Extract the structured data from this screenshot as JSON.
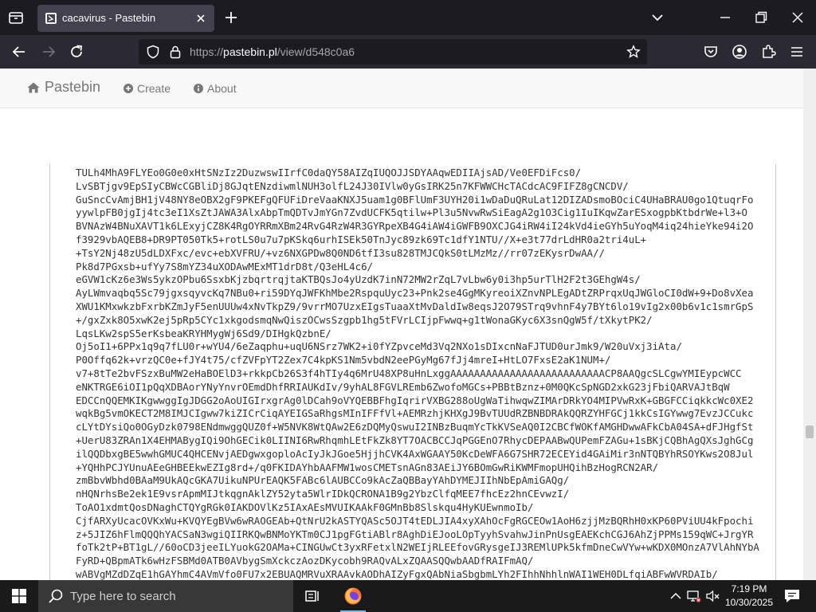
{
  "browser": {
    "tab": {
      "title": "cacavirus - Pastebin"
    },
    "url": {
      "prefix": "https://",
      "host": "pastebin.pl",
      "path": "/view/d548c0a6"
    }
  },
  "site": {
    "brand": "Pastebin",
    "nav": [
      {
        "label": "Create"
      },
      {
        "label": "About"
      }
    ]
  },
  "paste": {
    "lines": [
      "TULh4MhA9FLYEo0G0e0xHtSNzIz2DuzwswIIrfC0daQY58AIZqIUQOJJSDYAAqwEDIIAjsAD/Ve0EFDiFcs0/",
      "LvSBTjgv9EpSIyCBWcCGBliDj8GJqtENzdiwmlNUH3olfL24J30IVlw0yGsIRK25n7KFWWCHcTACdcAC9FIFZ8gCNCDV/",
      "GuSncCvAmjBH1jV48NY8eOBX2gF9PKEFgQFUFiDreVaaKNXJ5uam1g0BFlUmF3UYH20i1wDaDuQRuLat12DIZADsmoBOciC4UHaBRAU0go1QtuqrFo",
      "yywlpFB0jgIj4tc3eI1XsZtJAWA3AlxAbpTmQDTvJmYGn7ZvdUCFK5qtilw+Pl3u5NvwRwSiEagA2g1O3Cig1IuIKqwZarESxogpbKtbdrWe+l3+O",
      "BVNAzW4BNuXAVT1k6LExyjCZ8K4RgOYRRmXBm24RvG4RzW4R3GYRpeXB4G4iAW4iGWFB9OXCJG4iRW4iI24kVd4ieGYh5uYoqM4iq24hieYke94i2O",
      "f3929vbAQEB8+DR9PT050Tk5+rotLS0u7u7pKSkq6urhISEk50TnJyc89zk69Tc1dfY1NTU//X+e3t77drLdHR0a2tri4uL+",
      "+TsY2Nj48zU5dLDXFxc/evc+ebXVFRU/+vz6NXGPDw8Q0ND6tfI3su828TMJCQkS0tLMzMz//rr07zEKysrDwAA//",
      "Pk8d7PGxsb+ufYy7S8mYZ34uXODAwMExMT1drD8t/Q3eHL4c6/",
      "eGVW1cKz6e3Ws5ykzOPbu6SsxbKjzbqrtrqjtaKTBQsJo4yUzdK7inN72MW2rZqL7vLbw6y0i3hp5urTlH2F2t3GEhgW4s/",
      "AyLWmvaqbq5Sc79jgxsqyvcKq7NBu0+ri59DYqJWFKhMbe2RspquUyc23+Pnk2se4GgMKyreoiXZnvNPLEgADtZRPrqxUqJWGloCI0dW+9+Do8vXea",
      "XWU1KMxwkzbFxrbKZmJyF5enUUUw4xNvTkpZ9/9vrrMO7UzxEIgsTuaaXtMvDaldIw8eqsJ2O79STrq9vhnF4y7BYt6lo19vIg2x00b6v1c1smrGpS",
      "+/gxZxk8O5xwK2ej5pRp5CYc1xkgodsmqNwQiszOCwsSzgpb1hg5tFVrLCIjpFwwq+g1tWonaGKyc6X3snQgW5f/tXkytPK2/",
      "LqsLKw2spS5erKsbeaKRYHMygWj6Sd9/DIHgkQzbnE/",
      "Oj5oI1+6PPx1q9q7fLU0r+wYU4/6eZaqphu+uqU6NSrz7WK2+i0fYZpvceMd3Vq2NXo1sDIxcnNaFJTUD0urJmk9/W20uVxj3iAta/",
      "P0Offq62k+vrzQC0e+fJY4t75/cfZVFpYT2Zex7C4kpKS1Nm5vbdN2eePGyMg67fJj4mreI+HtLO7FxsE2aK1NUM+/",
      "v7+8tTe2bvFSzxBuMW2eHaBOElD3+rkkpCb26S3f4hTIy4q6MrU48XP8uHnLxggAAAAAAAAAAAAAAAAAAAAAAAAAACP8AAQgcSLCgwYMIEypcWCC",
      "eNKTRGE6iOI1pQqXDBAorYNyYnvrOEmdDhfRRIAUKdIv/9yhAL8FGVLREmb6ZwofoMGCs+PBBtBznz+0M0QKcSpNGD2xkG23jFbiQARVAJtBqW",
      "EDCCnQQEMKIKgwwggIgJDGG2oAoUIGIrxgrAg0lDCah9oVYQEBBFhgIqrirVXBG288oUgWaTihwqwZIMArDRkYO4MIPVwRxK+GBGFCCiqkkcWc0XE2",
      "wqkBg5vmOKECT2M8IMJCIgww7kiZICrCiqAYEIGSaRhgsMInIFFfVl+AEMRzhjKHXgJ9BvTUUdRZBNBDRAkQQRZYHFGCj1kkCsIGYwwg7EvzJCCukc",
      "cLYtDYsiQo0OGyDzk0798ENdmwggQUZ0f+W5NVK8WtQAw2E6zDQMyQswuI2INBzBuqmYcTkKVSeAQ0I2CBCfWOKfAMGHDwwAFkCbA04SA+dFJHgfSt",
      "+UerU83ZRAn1X4EHMABygIQi9OhGECik0LIINI6RwRhqmhLEtFkZk8YT7OACBCCJqPGGEnO7RhycDEPAABwQUPemFZAGu+1sBKjCQBhAgQXsJghGCg",
      "ilQQDbxgBE5wwhGMUC4QHCENvjAEDgwxgoploAcIyJkJGoe5HjjhCVK4AxWGAAY50KcDeWFA6G7SHR72ECEYid4GAiMir3nNTQBYhRSOYKws2O8Jul",
      "+YQHhPCJYUnuAEeGHBEEkwEZIg8rd+/q0FKIDAYhbAAFMW1wosCMETsnAGn83AEiJY6BOmGwRiKWMFmopUHQihBzHogRCN2AR/",
      "zmBbvWbhd0BAaM9UkAQcGKA7UikuNPUrEAQK5FABc6lAUBCCo9kAcZaQBBayYAhDYMEJIIhNbEpAmiGAQg/",
      "nHQNrhsBe2ek1E9vsrApmMIJtkqgnAklZY52yta5WlrIDkQCRONA1B9g2YbzClfqMEE7fhcEz2hnCEvwzI/",
      "ToAO1xdmtQosDNaghCTQYgRGk0IAKDOVlKz5IAxAEsMVUIKAAkF0GMnBb8Slskqu4HyKUEwnmoIb/",
      "CjfARXyUcacOVKxWu+KVQYEgBVw6wRAOGEAb+QtNrU2kASTYQASc5OJT4tEDLJIA4xyXAhOcFgRGCEOw1AoH6zjjMzBQRhH0xKP60PViUU4kFpochi",
      "z+5JIZ6hFlmQQQhYACSaN3wgiQIIRKQwBNMoYKTm0CJ1pgFGtiABlr8AghDiEJooLOpTyyhSvahwJinPnUsgEAEKchCGJ6AhZjPPMs159qWC+JrgYR",
      "foTk2tP+BT1gL//60oCD3jeeILYuokG2OAMa+CINGUwCt3yxRFetxlN2WEIjRLEEfovGRysgeIJ3REMlUPk5kfmDneCwVYw+wKDX0MOnzA7VlAhNYbA",
      "FyRD+QBpmATk6wHzFSBMd0ATB0AVbygSmXckczAozDKycobh9RAQvALxZQAASQQwbAADfRAIFmAQ/",
      "wABVgMZdDZqE1hGAYhmC4AVmVfo0FU7x2EBUAQMRVuXRAAvkAODhAIZyFgxQAbNiaSbgbmLYh2FIhhNhhlnWAI1WEH0DLfqiABFwWVRDAIb/"
    ]
  },
  "taskbar": {
    "search_placeholder": "Type here to search",
    "time": "7:19 PM",
    "date": "10/30/2025"
  }
}
